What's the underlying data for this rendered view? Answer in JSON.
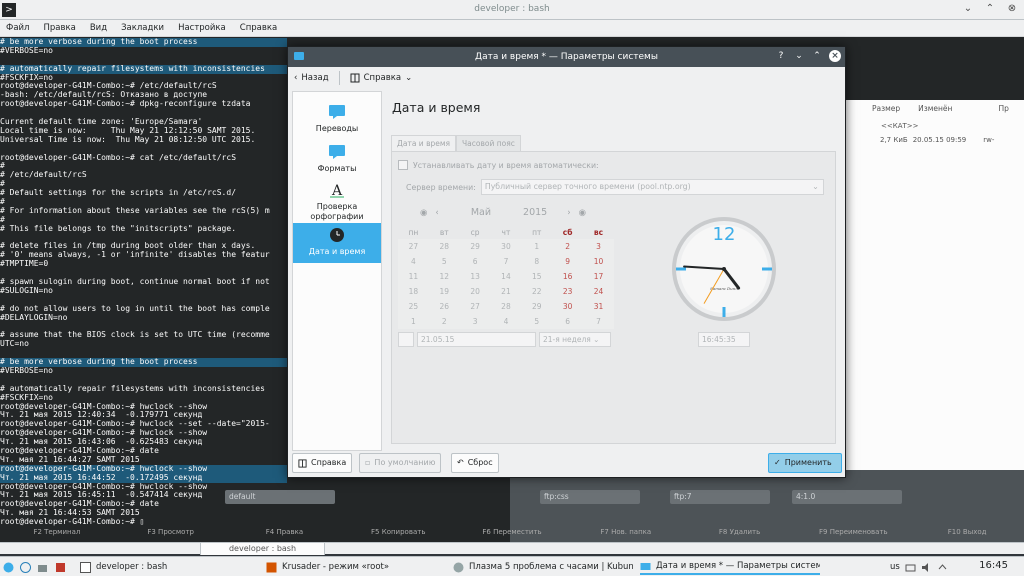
{
  "terminal_window": {
    "title": "developer : bash",
    "menu": [
      "Файл",
      "Правка",
      "Вид",
      "Закладки",
      "Настройка",
      "Справка"
    ],
    "lines": [
      {
        "text": "# be more verbose during the boot process",
        "hl": true
      },
      {
        "text": "#VERBOSE=no",
        "hl": false
      },
      {
        "text": "",
        "hl": false
      },
      {
        "text": "# automatically repair filesystems with inconsistencies",
        "hl": true
      },
      {
        "text": "#FSCKFIX=no",
        "hl": false
      },
      {
        "text": "root@developer-G41M-Combo:~# /etc/default/rcS",
        "hl": false
      },
      {
        "text": "-bash: /etc/default/rcS: Отказано в доступе",
        "hl": false
      },
      {
        "text": "root@developer-G41M-Combo:~# dpkg-reconfigure tzdata",
        "hl": false
      },
      {
        "text": "",
        "hl": false
      },
      {
        "text": "Current default time zone: 'Europe/Samara'",
        "hl": false
      },
      {
        "text": "Local time is now:     Thu May 21 12:12:50 SAMT 2015.",
        "hl": false
      },
      {
        "text": "Universal Time is now:  Thu May 21 08:12:50 UTC 2015.",
        "hl": false
      },
      {
        "text": "",
        "hl": false
      },
      {
        "text": "root@developer-G41M-Combo:~# cat /etc/default/rcS",
        "hl": false
      },
      {
        "text": "#",
        "hl": false
      },
      {
        "text": "# /etc/default/rcS",
        "hl": false
      },
      {
        "text": "#",
        "hl": false
      },
      {
        "text": "# Default settings for the scripts in /etc/rcS.d/",
        "hl": false
      },
      {
        "text": "#",
        "hl": false
      },
      {
        "text": "# For information about these variables see the rcS(5) m",
        "hl": false
      },
      {
        "text": "#",
        "hl": false
      },
      {
        "text": "# This file belongs to the \"initscripts\" package.",
        "hl": false
      },
      {
        "text": "",
        "hl": false
      },
      {
        "text": "# delete files in /tmp during boot older than x days.",
        "hl": false
      },
      {
        "text": "# '0' means always, -1 or 'infinite' disables the featur",
        "hl": false
      },
      {
        "text": "#TMPTIME=0",
        "hl": false
      },
      {
        "text": "",
        "hl": false
      },
      {
        "text": "# spawn sulogin during boot, continue normal boot if not",
        "hl": false
      },
      {
        "text": "#SULOGIN=no",
        "hl": false
      },
      {
        "text": "",
        "hl": false
      },
      {
        "text": "# do not allow users to log in until the boot has comple",
        "hl": false
      },
      {
        "text": "#DELAYLOGIN=no",
        "hl": false
      },
      {
        "text": "",
        "hl": false
      },
      {
        "text": "# assume that the BIOS clock is set to UTC time (recomme",
        "hl": false
      },
      {
        "text": "UTC=no",
        "hl": false
      },
      {
        "text": "",
        "hl": false
      },
      {
        "text": "# be more verbose during the boot process",
        "hl": true
      },
      {
        "text": "#VERBOSE=no",
        "hl": false
      },
      {
        "text": "",
        "hl": false
      },
      {
        "text": "# automatically repair filesystems with inconsistencies",
        "hl": false
      },
      {
        "text": "#FSCKFIX=no",
        "hl": false
      },
      {
        "text": "root@developer-G41M-Combo:~# hwclock --show",
        "hl": false
      },
      {
        "text": "Чт. 21 мая 2015 12:40:34  -0.179771 секунд",
        "hl": false
      },
      {
        "text": "root@developer-G41M-Combo:~# hwclock --set --date=\"2015-",
        "hl": false
      },
      {
        "text": "root@developer-G41M-Combo:~# hwclock --show",
        "hl": false
      },
      {
        "text": "Чт. 21 мая 2015 16:43:06  -0.625483 секунд",
        "hl": false
      },
      {
        "text": "root@developer-G41M-Combo:~# date",
        "hl": false
      },
      {
        "text": "Чт. мая 21 16:44:27 SAMT 2015",
        "hl": false
      },
      {
        "text": "root@developer-G41M-Combo:~# hwclock --show",
        "hl": true
      },
      {
        "text": "Чт. 21 мая 2015 16:44:52  -0.172495 секунд",
        "hl": true
      },
      {
        "text": "root@developer-G41M-Combo:~# hwclock --show",
        "hl": false
      },
      {
        "text": "Чт. 21 мая 2015 16:45:11  -0.547414 секунд",
        "hl": false
      },
      {
        "text": "root@developer-G41M-Combo:~# date",
        "hl": false
      },
      {
        "text": "Чт. мая 21 16:44:53 SAMT 2015",
        "hl": false
      },
      {
        "text": "root@developer-G41M-Combo:~# ▯",
        "hl": false
      }
    ],
    "bottom_tab": "developer : bash"
  },
  "background_app": {
    "headers": [
      "Размер",
      "Изменён",
      "Пр"
    ],
    "row1": "<<КАТ>>",
    "row2": [
      "2,7 КиБ",
      "20.05.15 09:59",
      "rw-"
    ],
    "inputs": [
      "default",
      "ftp:css",
      "ftp:7",
      "4:1.0"
    ],
    "fkeys": [
      "F2 Терминал",
      "F3 Просмотр",
      "F4 Правка",
      "F5 Копировать",
      "F6 Переместить",
      "F7 Нов. папка",
      "F8 Удалить",
      "F9 Переименовать",
      "F10 Выход"
    ]
  },
  "dialog": {
    "title": "Дата и время * — Параметры системы",
    "toolbar": {
      "back": "Назад",
      "help": "Справка"
    },
    "sidebar": [
      {
        "label": "Переводы",
        "icon": "speech-bubble-icon"
      },
      {
        "label": "Форматы",
        "icon": "speech-bubble-icon"
      },
      {
        "label": "Проверка орфографии",
        "icon": "spellcheck-icon"
      },
      {
        "label": "Дата и время",
        "icon": "clock-icon",
        "active": true
      }
    ],
    "page_title": "Дата и время",
    "tabs": [
      "Дата и время",
      "Часовой пояс"
    ],
    "auto_checkbox": "Устанавливать дату и время автоматически:",
    "server_label": "Сервер времени:",
    "server_value": "Публичный сервер точного времени (pool.ntp.org)",
    "calendar": {
      "month": "Май",
      "year": "2015",
      "weekdays": [
        "пн",
        "вт",
        "ср",
        "чт",
        "пт",
        "сб",
        "вс"
      ],
      "weeks": [
        [
          "27",
          "28",
          "29",
          "30",
          "1",
          "2",
          "3"
        ],
        [
          "4",
          "5",
          "6",
          "7",
          "8",
          "9",
          "10"
        ],
        [
          "11",
          "12",
          "13",
          "14",
          "15",
          "16",
          "17"
        ],
        [
          "18",
          "19",
          "20",
          "21",
          "22",
          "23",
          "24"
        ],
        [
          "25",
          "26",
          "27",
          "28",
          "29",
          "30",
          "31"
        ],
        [
          "1",
          "2",
          "3",
          "4",
          "5",
          "6",
          "7"
        ]
      ],
      "selected": "21"
    },
    "date_value": "21.05.15",
    "week_value": "21-я неделя",
    "time_value": "16:45:35",
    "clock": {
      "hours": 16,
      "minutes": 45,
      "seconds": 35,
      "brand": "Samara Dunn"
    },
    "buttons": {
      "help": "Справка",
      "defaults": "По умолчанию",
      "reset": "Сброс",
      "apply": "Применить"
    }
  },
  "taskbar": {
    "items": [
      "developer : bash",
      "Krusader - режим «root»",
      "Плазма 5 проблема с часами | Kubuntu...",
      "Дата и время * — Параметры системы"
    ],
    "locale": "us",
    "time": "16:45"
  }
}
